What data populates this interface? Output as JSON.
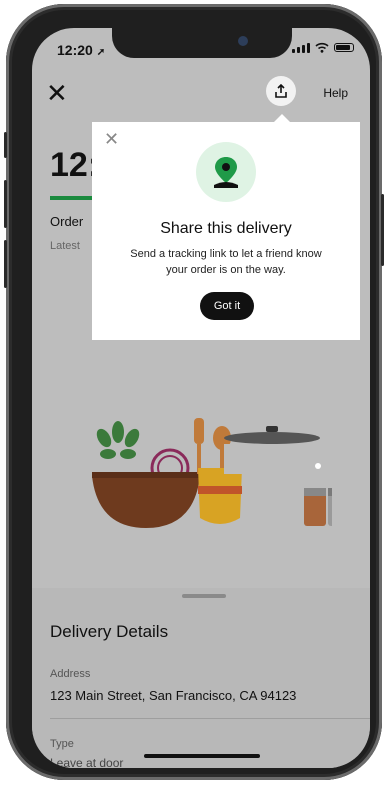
{
  "status_bar": {
    "time": "12:20"
  },
  "header": {
    "help_label": "Help"
  },
  "tracking": {
    "eta": "12:",
    "order_status": "Order",
    "latest_update": "Latest",
    "progress_fraction": 0.15
  },
  "popup": {
    "title": "Share this delivery",
    "body_line1": "Send a tracking link to let a friend know",
    "body_line2": "your order is on the way.",
    "button_label": "Got it"
  },
  "delivery_details": {
    "title": "Delivery Details",
    "address_label": "Address",
    "address_value": "123 Main Street, San Francisco, CA 94123",
    "type_label": "Type",
    "type_value": "Leave at door"
  },
  "colors": {
    "accent_green": "#1b8a3e",
    "overlay_gray": "#bdbdbd",
    "button_black": "#111111"
  },
  "icons": [
    "location-arrow-icon",
    "cellular-signal-icon",
    "wifi-icon",
    "battery-icon",
    "close-icon",
    "share-icon",
    "location-pin-icon",
    "popup-close-icon"
  ]
}
